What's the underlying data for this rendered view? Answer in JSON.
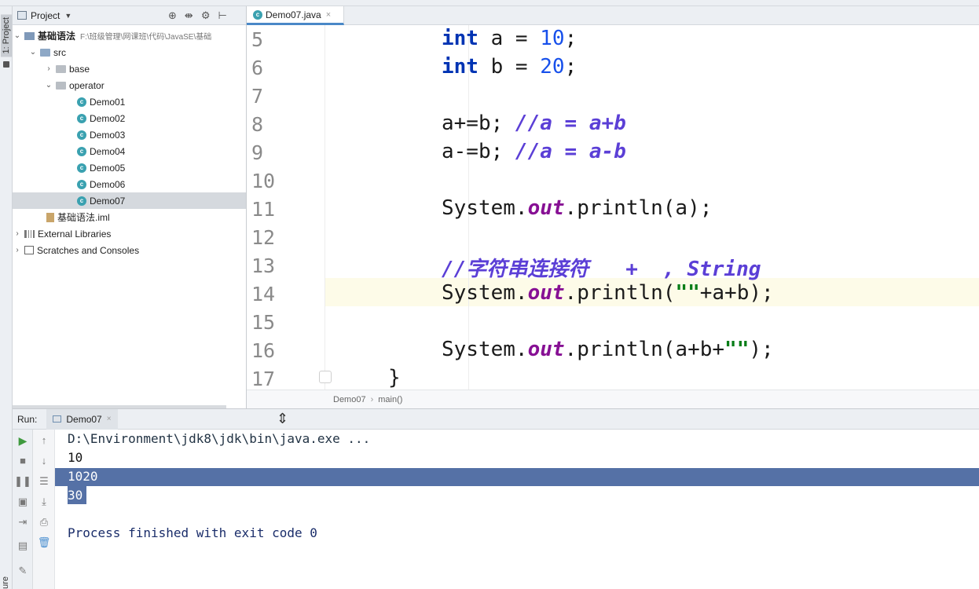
{
  "colors": {
    "selection": "#5571a6",
    "keyword": "#0033b3",
    "comment": "#5b3fd6",
    "field": "#871094",
    "string": "#067d17",
    "line_highlight": "#fdfbe8"
  },
  "tool_strip": {
    "project_label": "1: Project",
    "structure_label": "ure"
  },
  "project": {
    "title": "Project",
    "tree": [
      {
        "label": "基础语法",
        "path": "F:\\班级管理\\网课班\\代码\\JavaSE\\基础",
        "icon": "module-icon"
      },
      {
        "label": "src",
        "icon": "folder-icon"
      },
      {
        "label": "base",
        "icon": "package-icon"
      },
      {
        "label": "operator",
        "icon": "package-icon"
      },
      {
        "label": "Demo01",
        "icon": "class-icon"
      },
      {
        "label": "Demo02",
        "icon": "class-icon"
      },
      {
        "label": "Demo03",
        "icon": "class-icon"
      },
      {
        "label": "Demo04",
        "icon": "class-icon"
      },
      {
        "label": "Demo05",
        "icon": "class-icon"
      },
      {
        "label": "Demo06",
        "icon": "class-icon"
      },
      {
        "label": "Demo07",
        "icon": "class-icon"
      },
      {
        "label": "基础语法.iml",
        "icon": "iml-file-icon"
      },
      {
        "label": "External Libraries",
        "icon": "library-icon"
      },
      {
        "label": "Scratches and Consoles",
        "icon": "scratch-icon"
      }
    ]
  },
  "editor": {
    "tab": {
      "label": "Demo07.java"
    },
    "line_numbers": [
      "5",
      "6",
      "7",
      "8",
      "9",
      "10",
      "11",
      "12",
      "13",
      "14",
      "15",
      "16",
      "17"
    ],
    "code": {
      "l5": {
        "kw": "int",
        "rest1": " a = ",
        "num": "10",
        "rest2": ";"
      },
      "l6": {
        "kw": "int",
        "rest1": " b = ",
        "num": "20",
        "rest2": ";"
      },
      "l8": {
        "code": "a+=b; ",
        "comment": "//a = a+b"
      },
      "l9": {
        "code": "a-=b; ",
        "comment": "//a = a-b"
      },
      "l11": {
        "pre": "System.",
        "fld": "out",
        "post": ".println(a);"
      },
      "l13": {
        "comment": "//字符串连接符   +  , String"
      },
      "l14": {
        "pre": "System.",
        "fld": "out",
        "mid": ".println(",
        "str": "\"\"",
        "post": "+a+b);"
      },
      "l16": {
        "pre": "System.",
        "fld": "out",
        "mid": ".println(a+b+",
        "str": "\"\"",
        "post": ");"
      },
      "l17": {
        "brace": "}"
      }
    },
    "breadcrumb": {
      "class": "Demo07",
      "method": "main()"
    }
  },
  "run": {
    "label": "Run:",
    "tab": "Demo07",
    "console": {
      "cmd": "D:\\Environment\\jdk8\\jdk\\bin\\java.exe ...",
      "out1": "10",
      "out2": "1020",
      "out3": "30",
      "finish": "Process finished with exit code 0"
    }
  }
}
